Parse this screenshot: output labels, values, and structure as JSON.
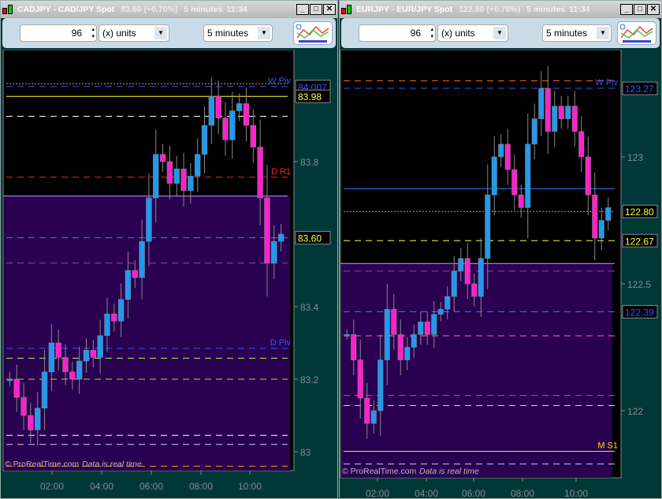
{
  "windows": [
    {
      "title": "CADJPY - CAD/JPY Spot",
      "price": "83.60 (+0.70%)",
      "timeframe": "5 minutes",
      "time": "11:34",
      "units_value": "96",
      "units_label": "(x) units",
      "period_select": "5 minutes",
      "copyright": "© ProRealTime.com",
      "realtime_note": "Data is real time",
      "y_ticks": [
        {
          "v": 83,
          "label": "83"
        },
        {
          "v": 83.2,
          "label": "83.2"
        },
        {
          "v": 83.4,
          "label": "83.4"
        },
        {
          "v": 83.6,
          "label": "83.6"
        },
        {
          "v": 83.8,
          "label": "83.8"
        }
      ],
      "x_ticks": [
        "02:00",
        "04:00",
        "06:00",
        "08:00",
        "10:00"
      ],
      "zone_top": 83.705,
      "levels": [
        {
          "v": 84.015,
          "color": "#ff9933",
          "style": "dot"
        },
        {
          "v": 84.007,
          "color": "#3355ff",
          "style": "dash",
          "label": "W Piv",
          "tag": "84.007",
          "tagColor": "#3355ff"
        },
        {
          "v": 83.98,
          "color": "#ffff33",
          "style": "solid",
          "tag": "83.98",
          "tagColor": "#ffff33"
        },
        {
          "v": 83.925,
          "color": "#ffffff",
          "style": "dash"
        },
        {
          "v": 83.757,
          "color": "#ff2222",
          "style": "dash",
          "label": "D R1"
        },
        {
          "v": 83.59,
          "color": "#2288ff",
          "style": "dash",
          "tag": "83.60",
          "tagColor": "#ffff33"
        },
        {
          "v": 83.52,
          "color": "#8844cc",
          "style": "dash"
        },
        {
          "v": 83.285,
          "color": "#3355ff",
          "style": "dash",
          "label": "D Piv"
        },
        {
          "v": 83.258,
          "color": "#99ff66",
          "style": "dash"
        },
        {
          "v": 83.2,
          "color": "#cccc33",
          "style": "dash"
        },
        {
          "v": 83.045,
          "color": "#ffffff",
          "style": "dash"
        },
        {
          "v": 83.02,
          "color": "#ccccff",
          "style": "dash"
        },
        {
          "v": 82.96,
          "color": "#ff9900",
          "style": "dash"
        }
      ],
      "closes": [
        83.2,
        83.15,
        83.1,
        83.06,
        83.12,
        83.22,
        83.3,
        83.26,
        83.22,
        83.2,
        83.25,
        83.28,
        83.26,
        83.32,
        83.38,
        83.36,
        83.42,
        83.5,
        83.48,
        83.58,
        83.7,
        83.82,
        83.8,
        83.74,
        83.78,
        83.72,
        83.76,
        83.82,
        83.9,
        83.98,
        83.92,
        83.86,
        83.94,
        83.96,
        83.9,
        83.84,
        83.7,
        83.52,
        83.58,
        83.6
      ]
    },
    {
      "title": "EURJPY - EUR/JPY Spot",
      "price": "122.80 (+0.78%)",
      "timeframe": "5 minutes",
      "time": "11:34",
      "units_value": "96",
      "units_label": "(x) units",
      "period_select": "5 minutes",
      "copyright": "© ProRealTime.com",
      "realtime_note": "Data is real time",
      "y_ticks": [
        {
          "v": 122,
          "label": "122"
        },
        {
          "v": 122.5,
          "label": "122.5"
        },
        {
          "v": 123,
          "label": "123"
        }
      ],
      "x_ticks": [
        "02:00",
        "04:00",
        "06:00",
        "08:00",
        "10:00"
      ],
      "zone_top": 122.58,
      "levels": [
        {
          "v": 123.3,
          "color": "#ff6622",
          "style": "dash"
        },
        {
          "v": 123.27,
          "color": "#3355ff",
          "style": "dash",
          "label": "W Piv",
          "tag": "123.27",
          "tagColor": "#3355ff"
        },
        {
          "v": 122.875,
          "color": "#2288ff",
          "style": "solid"
        },
        {
          "v": 122.785,
          "color": "#ff8833",
          "style": "dot",
          "tag": "122.80",
          "tagColor": "#ffff33"
        },
        {
          "v": 122.67,
          "color": "#ffff33",
          "style": "dash",
          "tag": "122.67",
          "tagColor": "#ffff33"
        },
        {
          "v": 122.55,
          "color": "#8844cc",
          "style": "dash"
        },
        {
          "v": 122.39,
          "color": "#2288ff",
          "style": "dash",
          "tag": "122.39",
          "tagColor": "#3355ff"
        },
        {
          "v": 122.295,
          "color": "#ff66cc",
          "style": "dash"
        },
        {
          "v": 122.06,
          "color": "#8866aa",
          "style": "dash"
        },
        {
          "v": 122.02,
          "color": "#ccccff",
          "style": "dash"
        },
        {
          "v": 121.84,
          "color": "#ffdd00",
          "style": "solid",
          "label": "M S1"
        },
        {
          "v": 121.79,
          "color": "#ccccff",
          "style": "dash"
        }
      ],
      "closes": [
        122.3,
        122.2,
        122.05,
        121.95,
        122.0,
        122.2,
        122.4,
        122.3,
        122.2,
        122.25,
        122.3,
        122.35,
        122.3,
        122.38,
        122.4,
        122.45,
        122.55,
        122.6,
        122.5,
        122.45,
        122.6,
        122.85,
        123.0,
        123.05,
        122.95,
        122.85,
        122.8,
        123.05,
        123.15,
        123.27,
        123.1,
        123.2,
        123.15,
        123.2,
        123.1,
        123.0,
        122.85,
        122.68,
        122.75,
        122.8
      ]
    }
  ],
  "colors": {
    "up": "#2299ee",
    "down": "#ff22cc",
    "wick": "#888888",
    "zone": "#2a0050",
    "bg": "#000000"
  },
  "icons": [
    "candlestick-logo-icon",
    "minimize-icon",
    "maximize-icon",
    "close-icon",
    "spinner-icon",
    "dropdown-icon",
    "indicators-icon"
  ]
}
